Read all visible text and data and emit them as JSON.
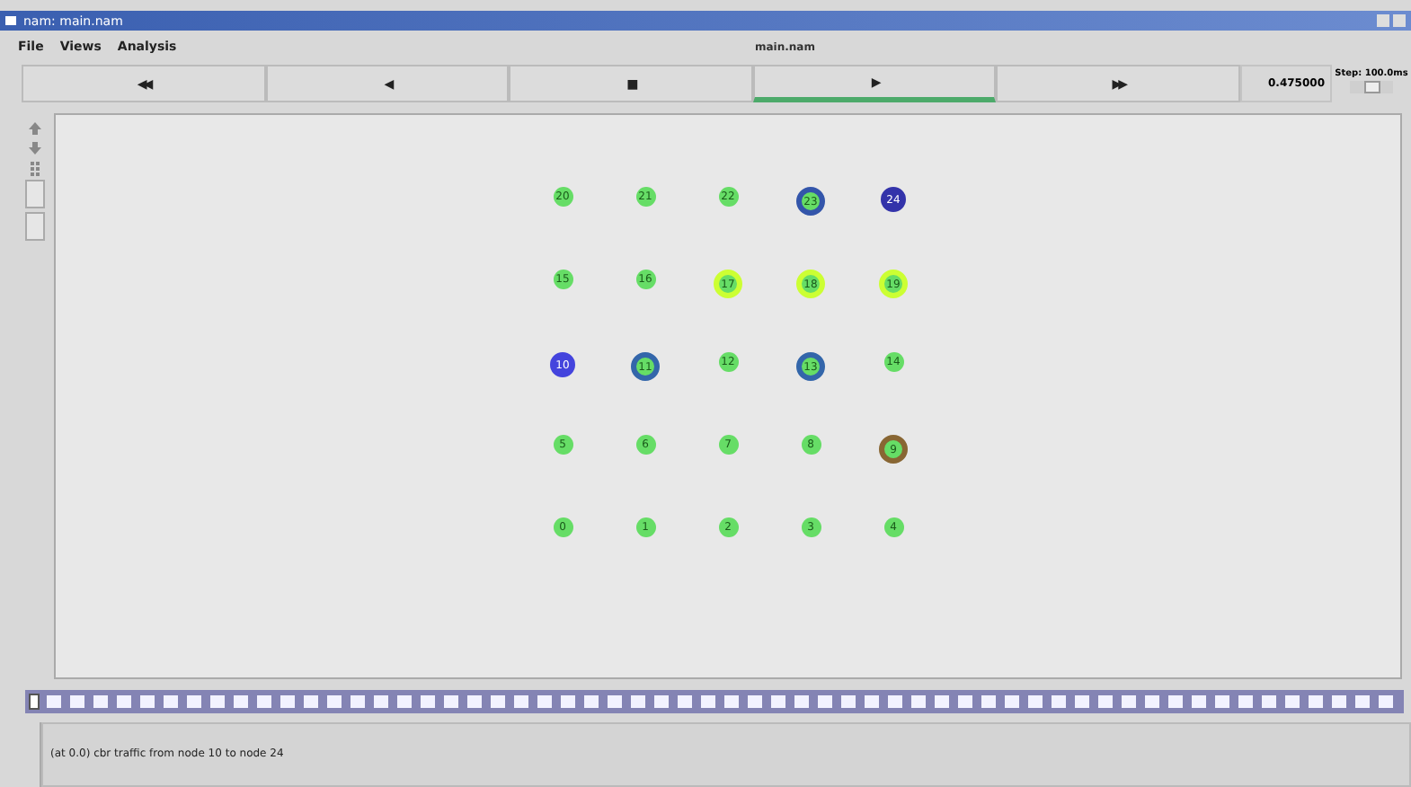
{
  "window": {
    "title": "nam: main.nam"
  },
  "menu": [
    "File",
    "Views",
    "Analysis"
  ],
  "file_name": "main.nam",
  "controls": [
    {
      "symbol": "◀◀",
      "selected": false
    },
    {
      "symbol": "◀",
      "selected": false
    },
    {
      "symbol": "■",
      "selected": false
    },
    {
      "symbol": "▶",
      "selected": true
    },
    {
      "symbol": "▶▶",
      "selected": false
    }
  ],
  "time": "0.475000",
  "step": {
    "label": "Step: 100.0ms",
    "level": 0.5
  },
  "nodes": [
    {
      "label": "20",
      "kind": "plain",
      "color": "#66dd66"
    },
    {
      "label": "21",
      "kind": "plain",
      "color": "#66dd66"
    },
    {
      "label": "22",
      "kind": "plain",
      "color": "#66dd66"
    },
    {
      "label": "23",
      "kind": "big",
      "color": "#3355aa"
    },
    {
      "label": "24",
      "kind": "core",
      "color": "#3333aa"
    },
    {
      "label": "15",
      "kind": "plain",
      "color": "#66dd66"
    },
    {
      "label": "16",
      "kind": "plain",
      "color": "#66dd66"
    },
    {
      "label": "17",
      "kind": "big",
      "color": "#ccff33"
    },
    {
      "label": "18",
      "kind": "big",
      "color": "#ccff33"
    },
    {
      "label": "19",
      "kind": "big",
      "color": "#ccff33"
    },
    {
      "label": "10",
      "kind": "core",
      "color": "#4444dd"
    },
    {
      "label": "11",
      "kind": "big",
      "color": "#3366aa"
    },
    {
      "label": "12",
      "kind": "plain",
      "color": "#66dd66"
    },
    {
      "label": "13",
      "kind": "big",
      "color": "#3366aa"
    },
    {
      "label": "14",
      "kind": "plain",
      "color": "#66dd66"
    },
    {
      "label": "5",
      "kind": "plain",
      "color": "#66dd66"
    },
    {
      "label": "6",
      "kind": "plain",
      "color": "#66dd66"
    },
    {
      "label": "7",
      "kind": "plain",
      "color": "#66dd66"
    },
    {
      "label": "8",
      "kind": "plain",
      "color": "#66dd66"
    },
    {
      "label": "9",
      "kind": "big",
      "color": "#886633"
    },
    {
      "label": "0",
      "kind": "plain",
      "color": "#66dd66"
    },
    {
      "label": "1",
      "kind": "plain",
      "color": "#66dd66"
    },
    {
      "label": "2",
      "kind": "plain",
      "color": "#66dd66"
    },
    {
      "label": "3",
      "kind": "plain",
      "color": "#66dd66"
    },
    {
      "label": "4",
      "kind": "plain",
      "color": "#66dd66"
    }
  ],
  "timeline": {
    "level": 0.0
  },
  "status": "(at 0.0) cbr traffic from node 10 to node 24"
}
